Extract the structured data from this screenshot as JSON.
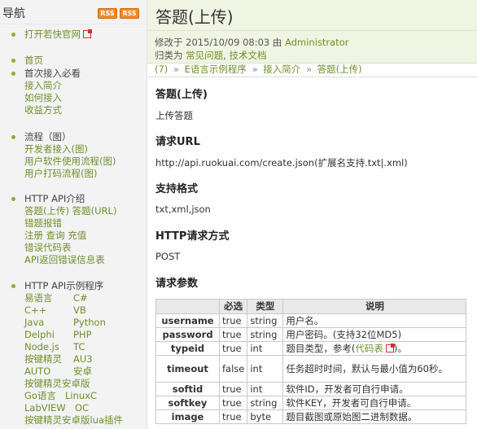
{
  "sidebar": {
    "title": "导航",
    "rss_label": "RSS",
    "items": [
      {
        "label": "打开若快官网",
        "type": "link",
        "external": true
      },
      {
        "label": "首页",
        "type": "link"
      },
      {
        "label": "首次接入必看",
        "type": "text"
      },
      {
        "label": "接入简介",
        "type": "link"
      },
      {
        "label": "如何接入",
        "type": "link"
      },
      {
        "label": "收益方式",
        "type": "link"
      },
      {
        "label": "流程（图）",
        "type": "text"
      },
      {
        "label": "开发者接入(图)",
        "type": "link"
      },
      {
        "label": "用户软件使用流程(图)",
        "type": "link"
      },
      {
        "label": "用户打码流程(图)",
        "type": "link"
      },
      {
        "label": "HTTP API介绍",
        "type": "text"
      },
      {
        "label": "答题(上传)",
        "label2": "答题(URL)",
        "type": "link-pair"
      },
      {
        "label": "错题报错",
        "type": "link"
      },
      {
        "label": "注册",
        "label2": "查询",
        "label3": "充值",
        "type": "link-triple"
      },
      {
        "label": "错误代码表",
        "type": "link"
      },
      {
        "label": "API返回错误信息表",
        "type": "link"
      },
      {
        "label": "HTTP API示例程序",
        "type": "text"
      },
      {
        "label": "易语言",
        "label2": "C#",
        "type": "link-pair"
      },
      {
        "label": "C++",
        "label2": "VB",
        "type": "link-pair"
      },
      {
        "label": "Java",
        "label2": "Python",
        "type": "link-pair"
      },
      {
        "label": "Delphi",
        "label2": "PHP",
        "type": "link-pair"
      },
      {
        "label": "Node.js",
        "label2": "TC",
        "type": "link-pair"
      },
      {
        "label": "按键精灵",
        "label2": "AU3",
        "type": "link-pair"
      },
      {
        "label": "AUTO",
        "label2": "安卓",
        "type": "link-pair"
      },
      {
        "label": "按键精灵安卓版",
        "type": "link"
      },
      {
        "label": "Go语言",
        "label2": "LinuxC",
        "type": "link-pair"
      },
      {
        "label": "LabVIEW",
        "label2": "OC",
        "type": "link-pair"
      },
      {
        "label": "按键精灵安卓版lua插件",
        "type": "link"
      }
    ]
  },
  "page": {
    "title": "答题(上传)",
    "modified_prefix": "修改于",
    "modified_date": "2015/10/09 08:03",
    "modified_by": "由",
    "author": "Administrator",
    "category_prefix": "归类为",
    "category1": "常见问题",
    "category_sep": ",",
    "category2": "技术文档",
    "breadcrumbs": [
      "(7)",
      "E语言示例程序",
      "接入简介",
      "答题(上传)"
    ],
    "breadcrumb_sep": "»"
  },
  "content": {
    "h_title": "答题(上传)",
    "p_title": "上传答题",
    "h_url": "请求URL",
    "p_url": "http://api.ruokuai.com/create.json(扩展名支持.txt|.xml)",
    "h_format": "支持格式",
    "p_format": "txt,xml,json",
    "h_method": "HTTP请求方式",
    "p_method": "POST",
    "h_params": "请求参数"
  },
  "table": {
    "headers": [
      "",
      "必选",
      "类型",
      "说明"
    ],
    "rows": [
      {
        "name": "username",
        "required": "true",
        "type": "string",
        "desc": "用户名。"
      },
      {
        "name": "password",
        "required": "true",
        "type": "string",
        "desc": "用户密码。(支持32位MD5)"
      },
      {
        "name": "typeid",
        "required": "true",
        "type": "int",
        "desc": "题目类型，参考(",
        "link": "代码表",
        "desc_end": ")。"
      },
      {
        "name": "timeout",
        "required": "false",
        "type": "int",
        "desc": "任务超时时间，默认与最小值为60秒。"
      },
      {
        "name": "softid",
        "required": "true",
        "type": "int",
        "desc": "软件ID，开发者可自行申请。"
      },
      {
        "name": "softkey",
        "required": "true",
        "type": "string",
        "desc": "软件KEY，开发者可自行申请。"
      },
      {
        "name": "image",
        "required": "true",
        "type": "byte",
        "desc": "题目截图或原始图二进制数据。"
      }
    ]
  },
  "colors": {
    "link": "#6f8f2a",
    "header_bg": "#f0f4e2",
    "sidebar_bg": "#f3f3f3",
    "rss": "#f08a2a"
  }
}
